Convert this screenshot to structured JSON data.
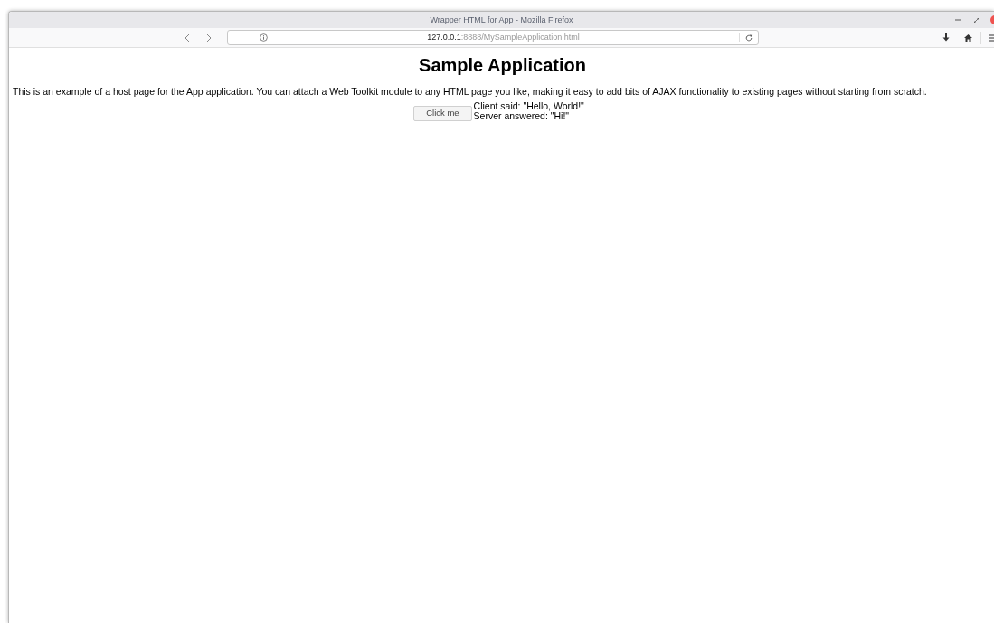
{
  "window": {
    "title": "Wrapper HTML for App - Mozilla Firefox"
  },
  "toolbar": {
    "url_host": "127.0.0.1",
    "url_path": ":8888/MySampleApplication.html"
  },
  "page": {
    "heading": "Sample Application",
    "intro": "This is an example of a host page for the App application. You can attach a Web Toolkit module to any HTML page you like, making it easy to add bits of AJAX functionality to existing pages without starting from scratch.",
    "button": "Click me",
    "messages": [
      "Client said: \"Hello, World!\"",
      "Server answered: \"Hi!\""
    ]
  }
}
